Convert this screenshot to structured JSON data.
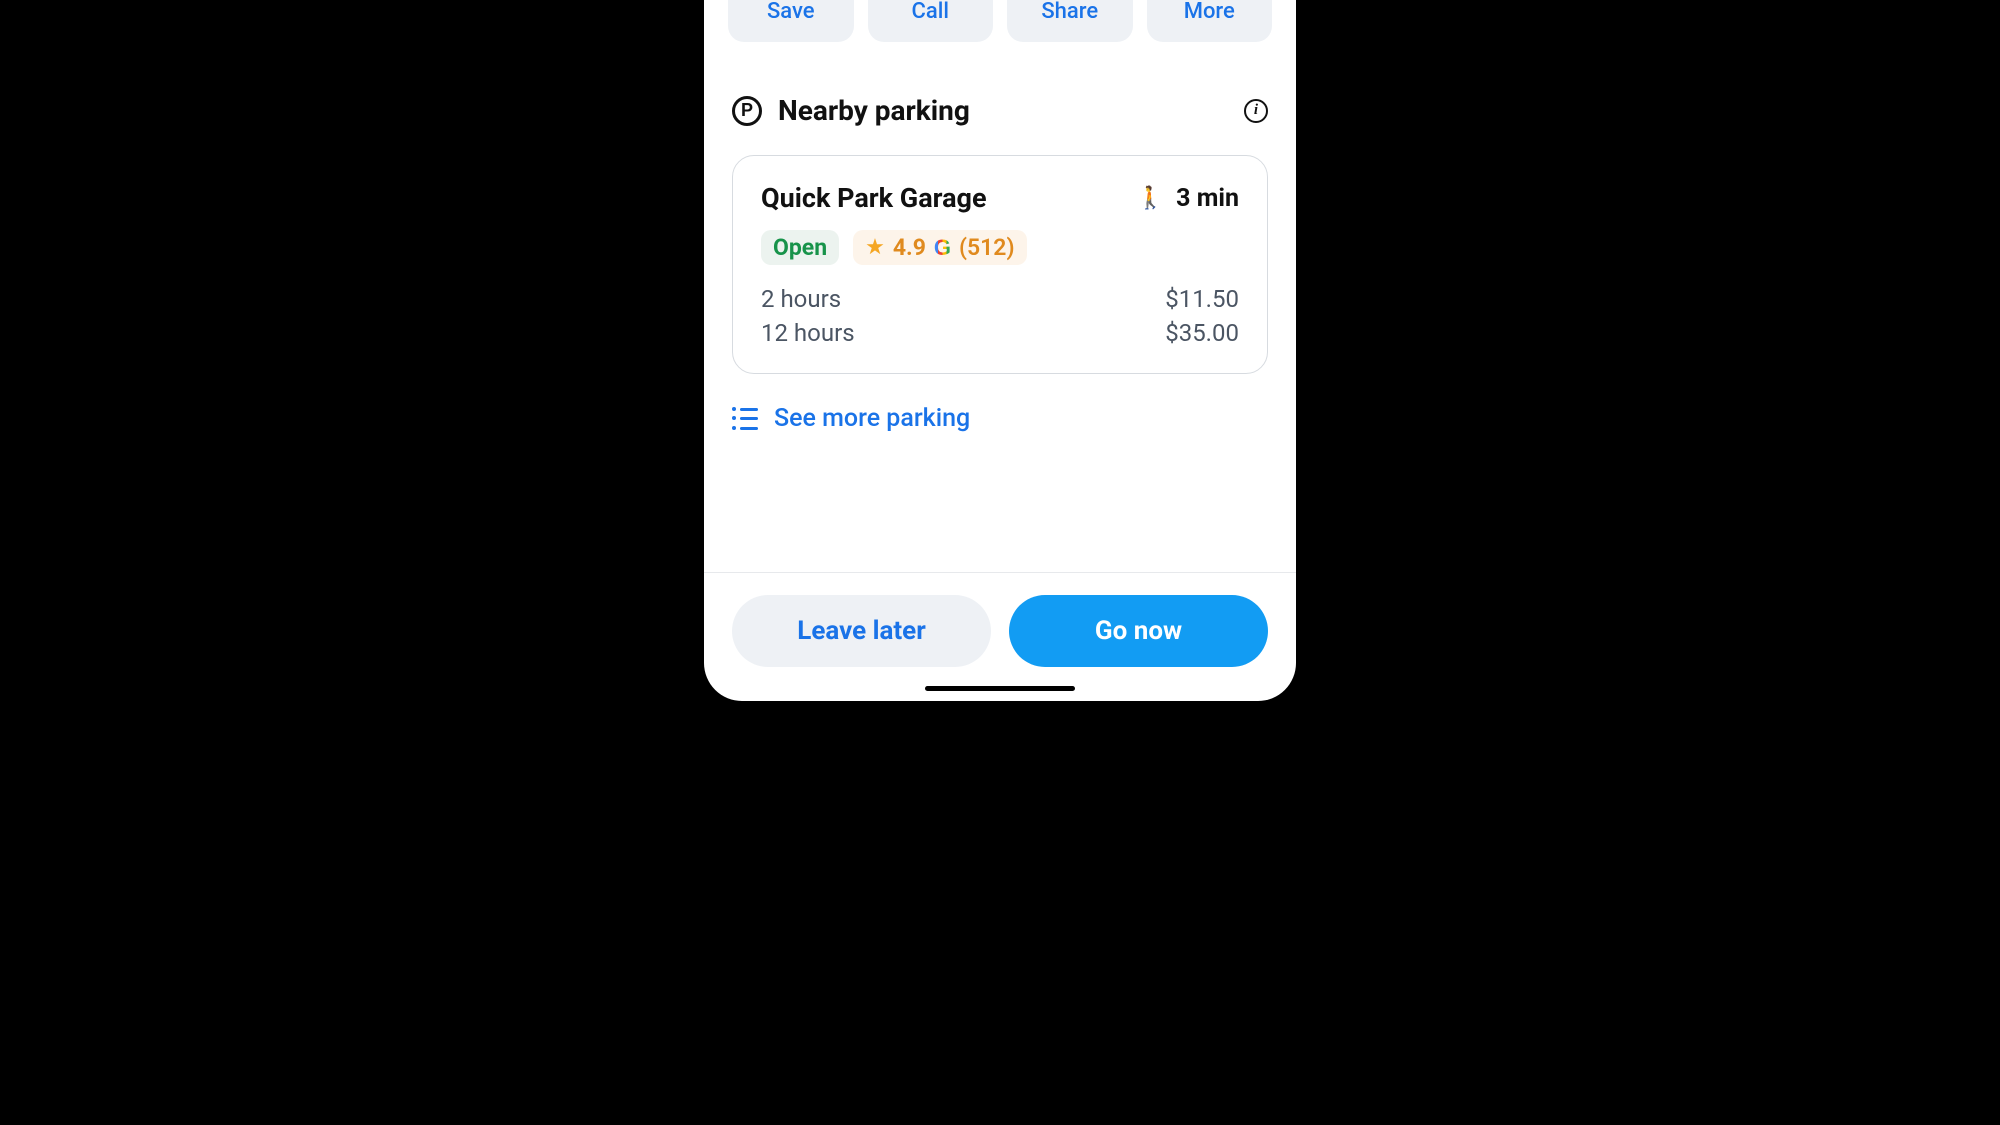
{
  "actions": {
    "save": "Save",
    "call": "Call",
    "share": "Share",
    "more": "More"
  },
  "section": {
    "title": "Nearby parking"
  },
  "parking": {
    "name": "Quick Park Garage",
    "walk_time": "3 min",
    "status": "Open",
    "rating": "4.9",
    "review_count": "(512)",
    "prices": [
      {
        "label": "2 hours",
        "amount": "$11.50"
      },
      {
        "label": "12 hours",
        "amount": "$35.00"
      }
    ]
  },
  "see_more": "See more parking",
  "footer": {
    "leave_later": "Leave later",
    "go_now": "Go now"
  }
}
